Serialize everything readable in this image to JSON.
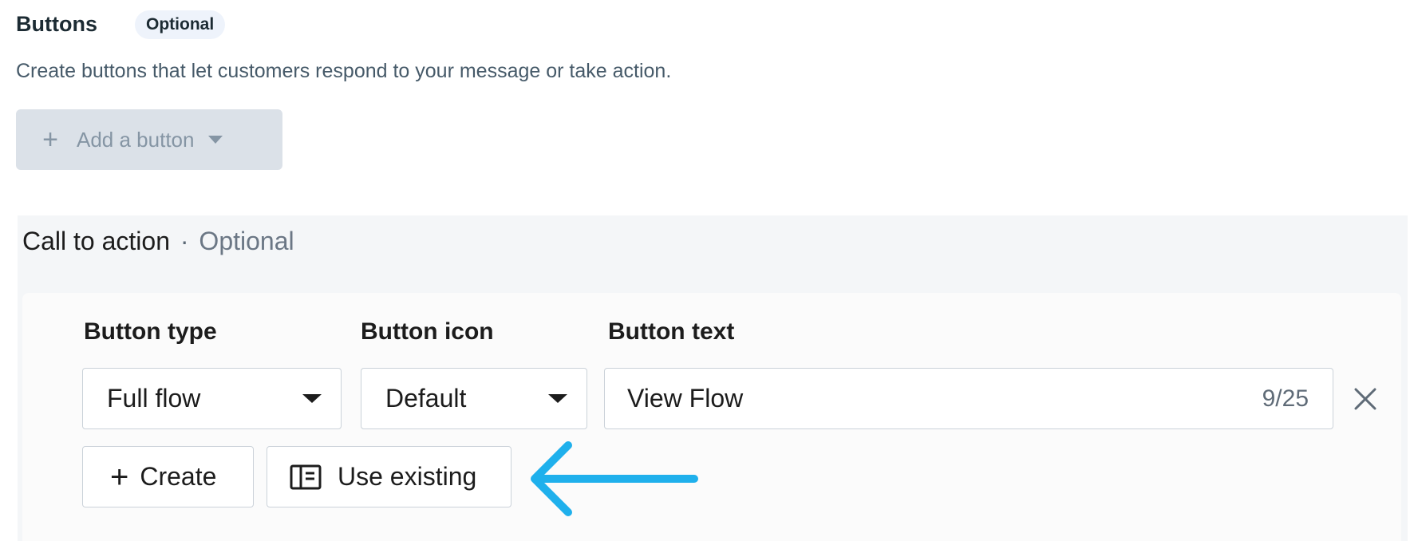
{
  "header": {
    "title": "Buttons",
    "badge": "Optional",
    "description": "Create buttons that let customers respond to your message or take action.",
    "add_button_label": "Add a button"
  },
  "cta": {
    "heading": "Call to action",
    "separator": "·",
    "optional_label": "Optional",
    "fields": {
      "button_type_label": "Button type",
      "button_icon_label": "Button icon",
      "button_text_label": "Button text"
    },
    "button_type_value": "Full flow",
    "button_icon_value": "Default",
    "button_text_value": "View Flow",
    "button_text_counter": "9/25",
    "create_label": "Create",
    "use_existing_label": "Use existing"
  },
  "icons": {
    "plus": "plus-icon",
    "caret": "caret-down-icon",
    "close": "close-icon",
    "existing": "flow-doc-icon",
    "annotation_arrow": "arrow-left-icon"
  },
  "colors": {
    "annotation_arrow": "#1fb0ec",
    "disabled_button_bg": "#dbe1e8",
    "badge_bg": "#eef3fb",
    "panel_bg": "#f4f6f8"
  }
}
